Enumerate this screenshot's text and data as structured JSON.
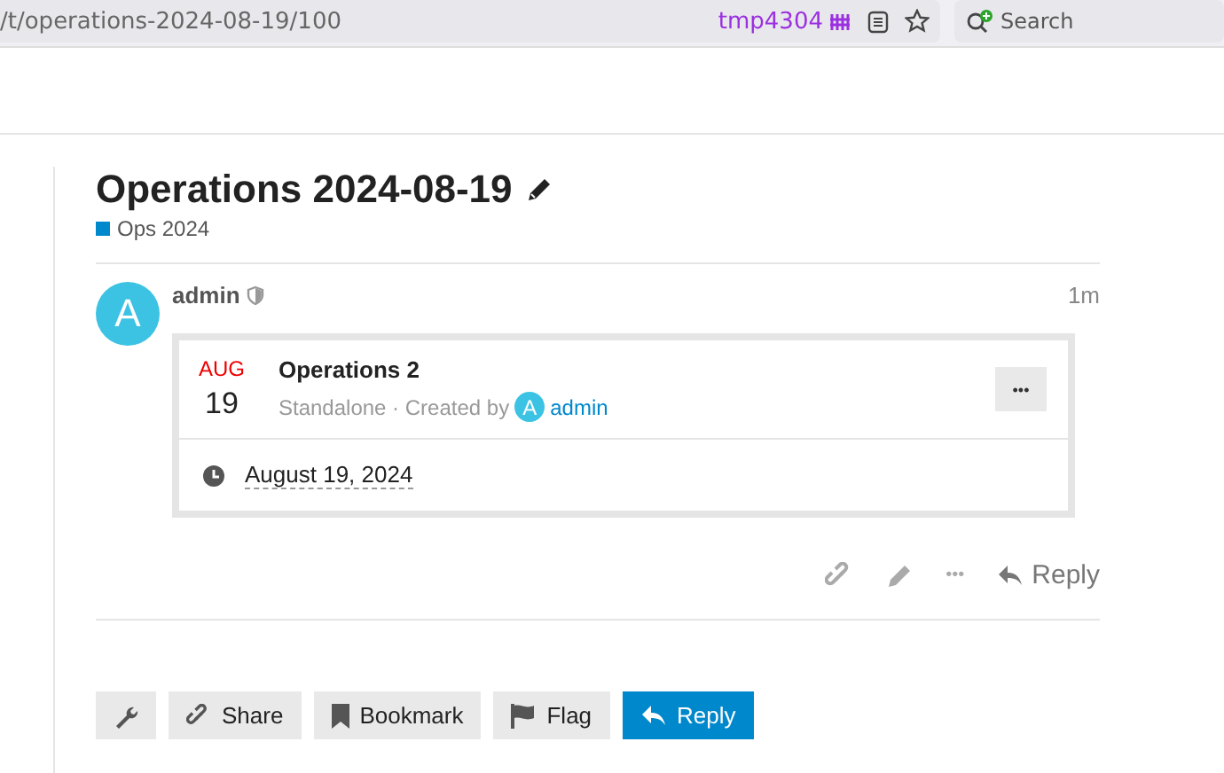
{
  "browser": {
    "url": "/t/operations-2024-08-19/100",
    "container_label": "tmp4304",
    "search": {
      "placeholder": "Search"
    }
  },
  "topic": {
    "title": "Operations 2024-08-19",
    "category": {
      "name": "Ops 2024",
      "color": "#0088cc"
    }
  },
  "post": {
    "author": "admin",
    "avatar_letter": "A",
    "age": "1m",
    "event": {
      "month": "AUG",
      "day": "19",
      "name": "Operations 2",
      "status_line": "Standalone · Created by",
      "creator_avatar_letter": "A",
      "creator": "admin",
      "date": "August 19, 2024",
      "menu": "•••"
    },
    "actions": {
      "more": "•••",
      "reply": "Reply"
    }
  },
  "footer_buttons": [
    {
      "kind": "admin"
    },
    {
      "kind": "share",
      "label": "Share"
    },
    {
      "kind": "bookmark",
      "label": "Bookmark"
    },
    {
      "kind": "flag",
      "label": "Flag"
    },
    {
      "kind": "reply",
      "label": "Reply"
    }
  ]
}
